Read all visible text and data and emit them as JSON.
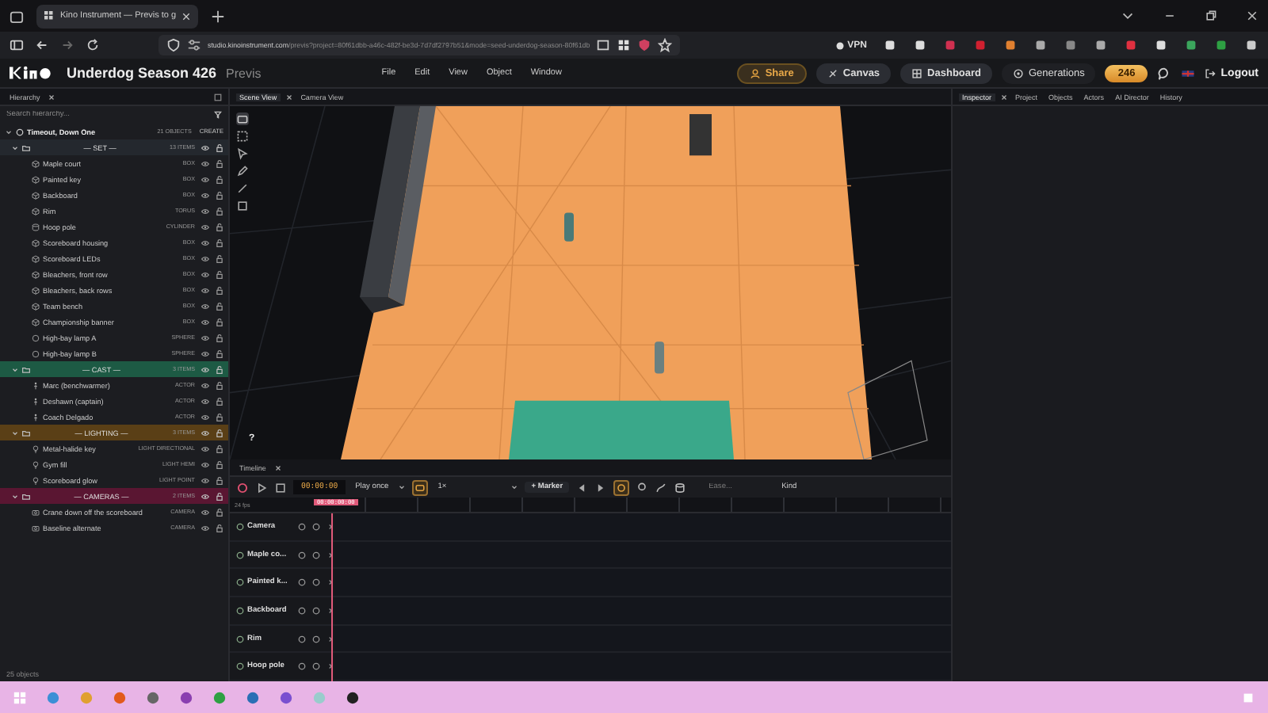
{
  "browser": {
    "tab_title": "Kino Instrument — Previs to g",
    "url_host": "studio.kinoinstrument.com",
    "url_path": "/previs?project=80f61dbb-a46c-482f-be3d-7d7df2797b51&mode=seed-underdog-season-80f61db",
    "vpn": "VPN"
  },
  "app": {
    "title": "Underdog Season 426",
    "subtitle": "Previs",
    "menu": [
      "File",
      "Edit",
      "View",
      "Object",
      "Window"
    ],
    "buttons": [
      {
        "label": "Share",
        "kind": "share"
      },
      {
        "label": "Canvas",
        "kind": "canvas"
      },
      {
        "label": "Dashboard",
        "kind": "dashboard"
      },
      {
        "label": "Generations",
        "kind": "generations"
      }
    ],
    "credits": "246",
    "logout": "Logout"
  },
  "hierarchy": {
    "tab": "Hierarchy",
    "search": {
      "placeholder": "Search hierarchy..."
    },
    "root": {
      "name": "Timeout, Down One",
      "count": "21 OBJECTS",
      "action": "CREATE",
      "expanded": true
    },
    "groups": [
      {
        "name": "— SET —",
        "count": "13 ITEMS",
        "color": "#24282e",
        "expanded": true,
        "children": [
          {
            "name": "Maple court",
            "type": "BOX",
            "kind": "mesh"
          },
          {
            "name": "Painted key",
            "type": "BOX",
            "kind": "mesh"
          },
          {
            "name": "Backboard",
            "type": "BOX",
            "kind": "mesh"
          },
          {
            "name": "Rim",
            "type": "TORUS",
            "kind": "mesh"
          },
          {
            "name": "Hoop pole",
            "type": "CYLINDER",
            "kind": "cylinder"
          },
          {
            "name": "Scoreboard housing",
            "type": "BOX",
            "kind": "mesh"
          },
          {
            "name": "Scoreboard LEDs",
            "type": "BOX",
            "kind": "mesh"
          },
          {
            "name": "Bleachers, front row",
            "type": "BOX",
            "kind": "mesh"
          },
          {
            "name": "Bleachers, back rows",
            "type": "BOX",
            "kind": "mesh"
          },
          {
            "name": "Team bench",
            "type": "BOX",
            "kind": "mesh"
          },
          {
            "name": "Championship banner",
            "type": "BOX",
            "kind": "mesh"
          },
          {
            "name": "High-bay lamp A",
            "type": "SPHERE",
            "kind": "sphere"
          },
          {
            "name": "High-bay lamp B",
            "type": "SPHERE",
            "kind": "sphere"
          }
        ]
      },
      {
        "name": "— CAST —",
        "count": "3 ITEMS",
        "color": "#1d5a44",
        "expanded": true,
        "children": [
          {
            "name": "Marc (benchwarmer)",
            "type": "ACTOR",
            "kind": "actor"
          },
          {
            "name": "Deshawn (captain)",
            "type": "ACTOR",
            "kind": "actor"
          },
          {
            "name": "Coach Delgado",
            "type": "ACTOR",
            "kind": "actor"
          }
        ]
      },
      {
        "name": "— LIGHTING —",
        "count": "3 ITEMS",
        "color": "#5a3f16",
        "expanded": true,
        "children": [
          {
            "name": "Metal-halide key",
            "type": "LIGHT DIRECTIONAL",
            "kind": "light"
          },
          {
            "name": "Gym fill",
            "type": "LIGHT HEMI",
            "kind": "light"
          },
          {
            "name": "Scoreboard glow",
            "type": "LIGHT POINT",
            "kind": "light"
          }
        ]
      },
      {
        "name": "— CAMERAS —",
        "count": "2 ITEMS",
        "color": "#5a1632",
        "expanded": true,
        "children": [
          {
            "name": "Crane down off the scoreboard",
            "type": "CAMERA",
            "kind": "camera"
          },
          {
            "name": "Baseline alternate",
            "type": "CAMERA",
            "kind": "camera"
          }
        ]
      }
    ],
    "footer": "25 objects"
  },
  "viewport": {
    "tabs": [
      {
        "label": "Scene View",
        "selected": true
      },
      {
        "label": "Camera View",
        "selected": false
      }
    ],
    "help": "?"
  },
  "timeline": {
    "tab": "Timeline",
    "time": "00:00:00",
    "loop": "Play once",
    "speed": "1×",
    "marker": "+ Marker",
    "ease_placeholder": "Ease...",
    "kind_filter": "Kind",
    "fps": "24 fps",
    "playhead": "00:00:00:00",
    "tracks": [
      {
        "name": "Camera"
      },
      {
        "name": "Maple co..."
      },
      {
        "name": "Painted k..."
      },
      {
        "name": "Backboard"
      },
      {
        "name": "Rim"
      },
      {
        "name": "Hoop pole"
      }
    ]
  },
  "inspector": {
    "tabs": [
      {
        "label": "Inspector",
        "selected": true
      },
      {
        "label": "Project",
        "selected": false
      },
      {
        "label": "Objects",
        "selected": false
      },
      {
        "label": "Actors",
        "selected": false
      },
      {
        "label": "AI Director",
        "selected": false
      },
      {
        "label": "History",
        "selected": false
      }
    ]
  }
}
